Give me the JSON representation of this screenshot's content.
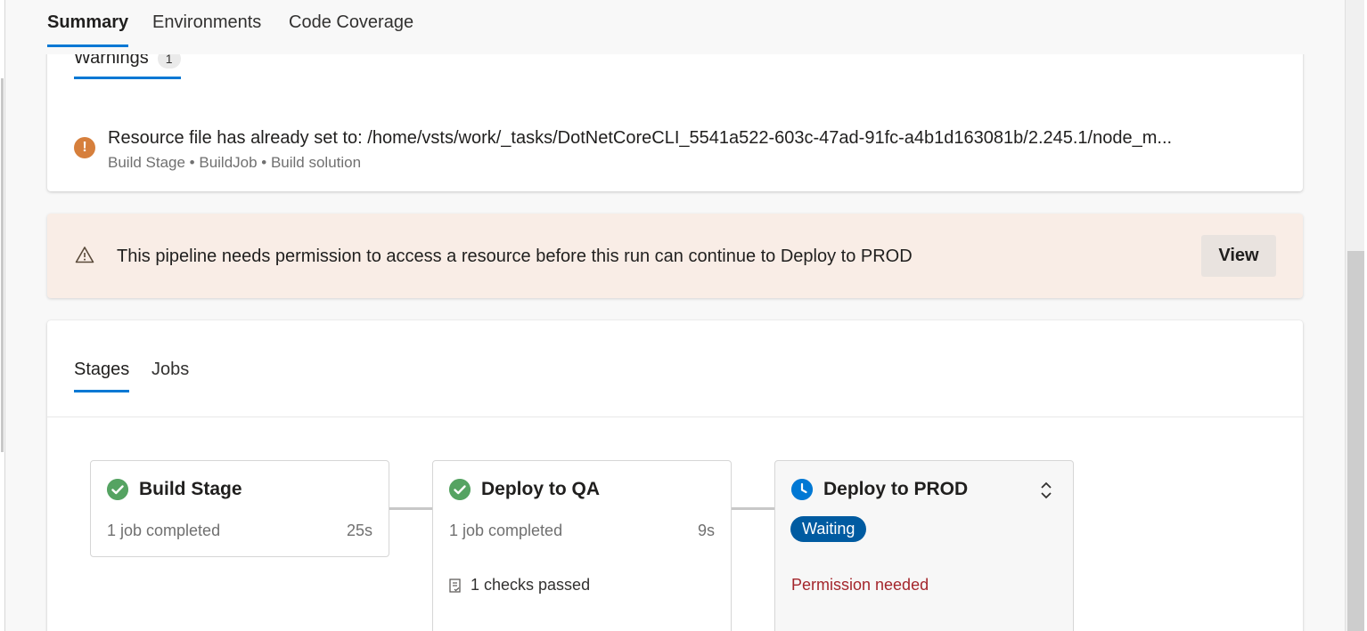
{
  "tabs": [
    {
      "label": "Summary",
      "active": true
    },
    {
      "label": "Environments",
      "active": false
    },
    {
      "label": "Code Coverage",
      "active": false
    }
  ],
  "warnings": {
    "tab_label": "Warnings",
    "count": "1",
    "icon": "exclamation-icon",
    "message": "Resource file has already set to: /home/vsts/work/_tasks/DotNetCoreCLI_5541a522-603c-47ad-91fc-a4b1d163081b/2.245.1/node_m...",
    "path": "Build Stage • BuildJob • Build solution"
  },
  "banner": {
    "icon": "warning-triangle-icon",
    "text": "This pipeline needs permission to access a resource before this run can continue to Deploy to PROD",
    "button_label": "View",
    "bg_color": "#f9ede6"
  },
  "stages_panel": {
    "tabs": [
      {
        "label": "Stages",
        "active": true
      },
      {
        "label": "Jobs",
        "active": false
      }
    ],
    "stages": [
      {
        "name": "Build Stage",
        "status": "succeeded",
        "summary": "1 job completed",
        "duration": "25s"
      },
      {
        "name": "Deploy to QA",
        "status": "succeeded",
        "summary": "1 job completed",
        "duration": "9s",
        "checks": "1 checks passed"
      },
      {
        "name": "Deploy to PROD",
        "status": "waiting",
        "badge": "Waiting",
        "message": "Permission needed"
      }
    ]
  },
  "colors": {
    "accent": "#0078d4",
    "success": "#55a362",
    "warning": "#d67f3c",
    "error": "#a4262c",
    "waiting_badge": "#005ba1"
  }
}
